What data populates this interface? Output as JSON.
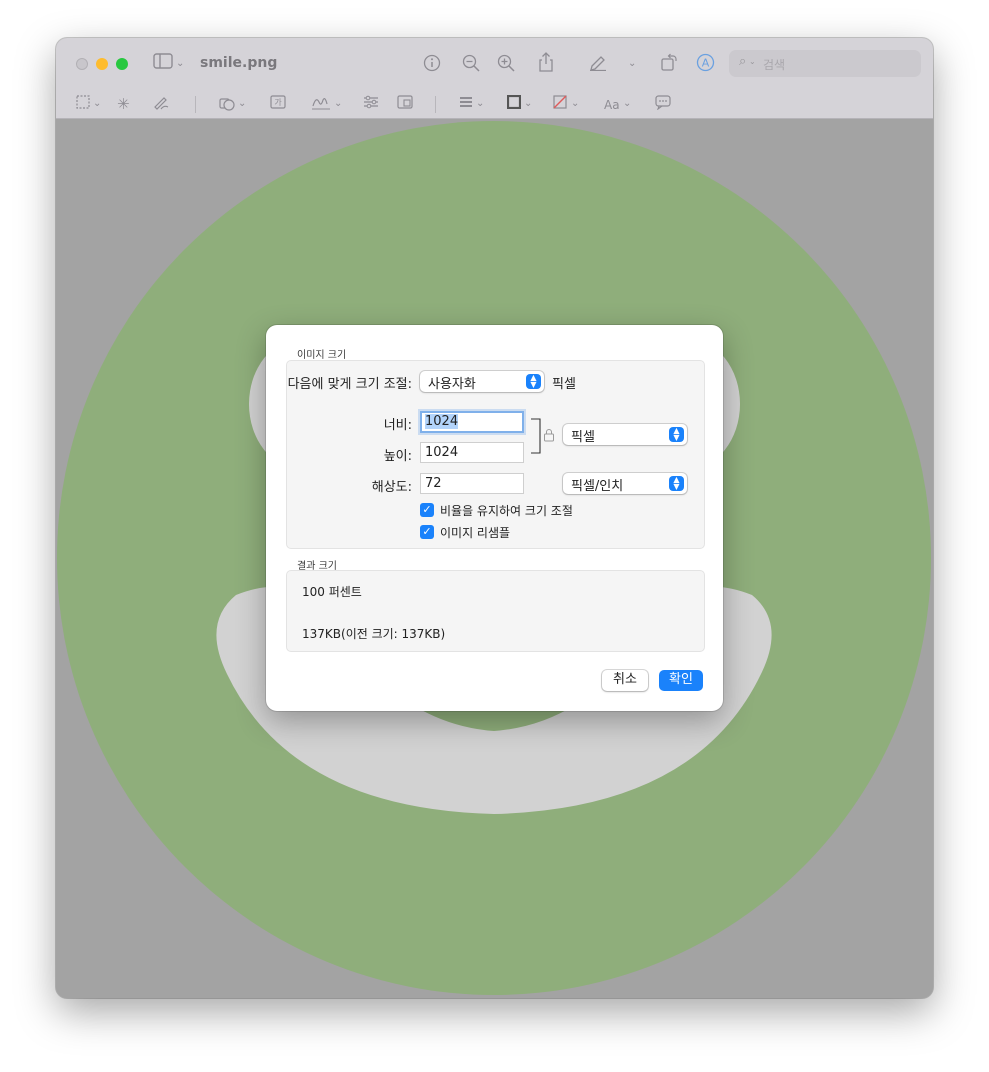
{
  "window": {
    "title": "smile.png",
    "search_placeholder": "검색",
    "traffic_lights": [
      "#c8c6cb",
      "#febc2e",
      "#28c840"
    ]
  },
  "canvas": {
    "face_color": "#8fae7b",
    "feature_color": "#d2d2d2",
    "overlay_color": "#a3a3a3"
  },
  "dialog": {
    "section_image_size": "이미지 크기",
    "fit_label": "다음에 맞게 크기 조절:",
    "fit_value": "사용자화",
    "fit_unit": "픽셀",
    "width_label": "너비:",
    "width_value": "1024",
    "height_label": "높이:",
    "height_value": "1024",
    "size_unit": "픽셀",
    "resolution_label": "해상도:",
    "resolution_value": "72",
    "resolution_unit": "픽셀/인치",
    "keep_ratio_label": "비율을 유지하여 크기 조절",
    "keep_ratio_checked": true,
    "resample_label": "이미지 리샘플",
    "resample_checked": true,
    "section_result": "결과 크기",
    "result_percent": "100 퍼센트",
    "result_size": "137KB(이전 크기: 137KB)",
    "cancel": "취소",
    "ok": "확인"
  },
  "colors": {
    "accent": "#1a82fb"
  }
}
